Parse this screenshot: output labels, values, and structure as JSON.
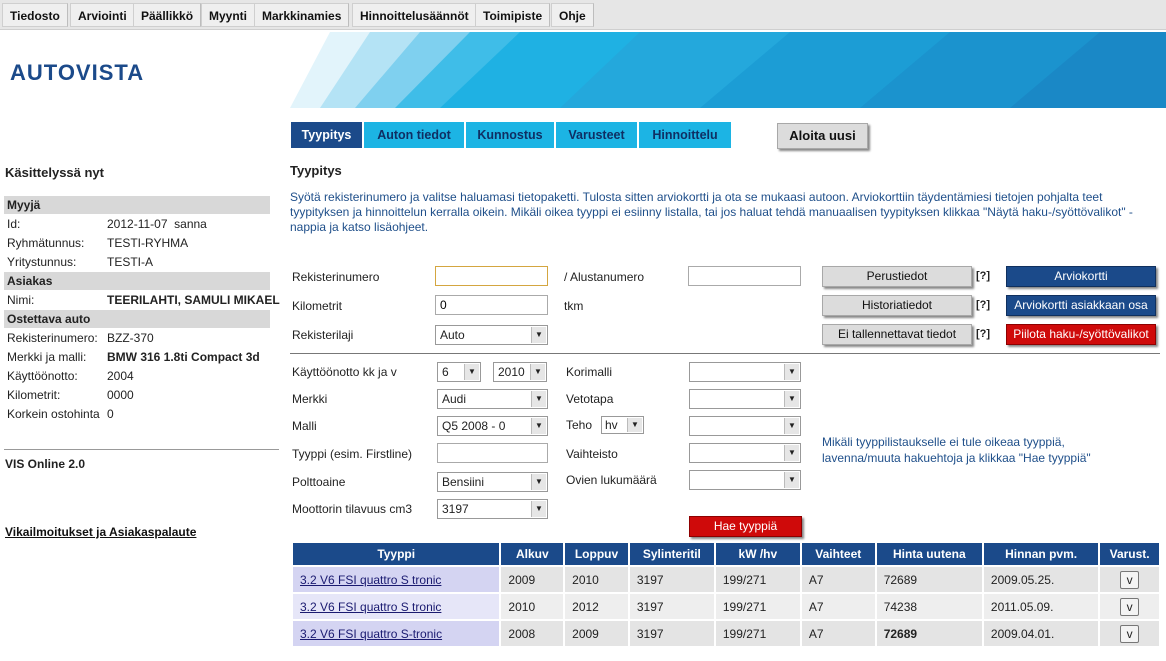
{
  "menu": [
    "Tiedosto",
    "Arviointi",
    "Päällikkö",
    "Myynti",
    "Markkinamies",
    "Hinnoittelusäännöt",
    "Toimipiste",
    "Ohje"
  ],
  "brand": "AUTOVISTA",
  "tabs": [
    "Tyypitys",
    "Auton tiedot",
    "Kunnostus",
    "Varusteet",
    "Hinnoittelu"
  ],
  "start_over": "Aloita uusi",
  "sidebar": {
    "title": "Käsittelyssä nyt",
    "myyja_head": "Myyjä",
    "id_label": "Id:",
    "id_value": "2012-11-07  sanna",
    "group_label": "Ryhmätunnus:",
    "group_value": "TESTI-RYHMA",
    "company_label": "Yritystunnus:",
    "company_value": "TESTI-A",
    "asiakas_head": "Asiakas",
    "name_label": "Nimi:",
    "name_value": "TEERILAHTI, SAMULI MIKAEL",
    "car_head": "Ostettava auto",
    "reg_label": "Rekisterinumero:",
    "reg_value": "BZZ-370",
    "make_label": "Merkki ja malli:",
    "make_value": "BMW 316 1.8ti Compact 3d",
    "use_label": "Käyttöönotto:",
    "use_value": "2004",
    "km_label": "Kilometrit:",
    "km_value": "0000",
    "max_label": "Korkein ostohinta",
    "max_value": "0",
    "version": "VIS Online 2.0",
    "feedback": "Vikailmoitukset ja Asiakaspalaute"
  },
  "section_title": "Tyypitys",
  "intro": "Syötä rekisterinumero ja valitse haluamasi tietopaketti. Tulosta sitten arviokortti ja ota se mukaasi autoon. Arviokorttiin täydentämiesi tietojen pohjalta teet tyypityksen ja hinnoittelun kerralla oikein. Mikäli oikea tyyppi ei esiinny listalla, tai jos haluat tehdä manuaalisen tyypityksen klikkaa \"Näytä haku-/syöttövalikot\" -nappia ja katso lisäohjeet.",
  "form": {
    "reg_label": "Rekisterinumero",
    "reg_value": "",
    "chassis_label": "/ Alustanumero",
    "chassis_value": "",
    "km_label": "Kilometrit",
    "km_value": "0",
    "km_unit": "tkm",
    "reglaji_label": "Rekisterilaji",
    "reglaji_value": "Auto",
    "kaytto_label": "Käyttöönotto kk ja v",
    "kaytto_month": "6",
    "kaytto_year": "2010",
    "merkki_label": "Merkki",
    "merkki_value": "Audi",
    "malli_label": "Malli",
    "malli_value": "Q5 2008 - 0",
    "tyyppi_label": "Tyyppi (esim. Firstline)",
    "tyyppi_value": "",
    "polttoaine_label": "Polttoaine",
    "polttoaine_value": "Bensiini",
    "tilavuus_label": "Moottorin tilavuus cm3",
    "tilavuus_value": "3197",
    "korimalli_label": "Korimalli",
    "vetotapa_label": "Vetotapa",
    "teho_label": "Teho",
    "teho_unit": "hv",
    "vaihteisto_label": "Vaihteisto",
    "ovet_label": "Ovien lukumäärä",
    "hint": "Mikäli tyyppilistaukselle ei tule oikeaa tyyppiä, lavenna/muuta hakuehtoja ja klikkaa \"Hae tyyppiä\"",
    "search_button": "Hae tyyppiä"
  },
  "buttons": {
    "perustiedot": "Perustiedot",
    "historiatiedot": "Historiatiedot",
    "ei_tallennettavat": "Ei tallennettavat tiedot",
    "help": "[?]",
    "arviokortti": "Arviokortti",
    "arviokortti_asiakas": "Arviokortti asiakkaan osa",
    "piilota": "Piilota haku-/syöttövalikot"
  },
  "table": {
    "headers": [
      "Tyyppi",
      "Alkuv",
      "Loppuv",
      "Sylinteritil",
      "kW /hv",
      "Vaihteet",
      "Hinta uutena",
      "Hinnan pvm.",
      "Varust."
    ],
    "rows": [
      [
        "3.2 V6 FSI quattro S tronic",
        "2009",
        "2010",
        "3197",
        "199/271",
        "A7",
        "72689",
        "2009.05.25.",
        "v"
      ],
      [
        "3.2 V6 FSI quattro S tronic",
        "2010",
        "2012",
        "3197",
        "199/271",
        "A7",
        "74238",
        "2011.05.09.",
        "v"
      ],
      [
        "3.2 V6 FSI quattro S-tronic",
        "2008",
        "2009",
        "3197",
        "199/271",
        "A7",
        "72689",
        "2009.04.01.",
        "v"
      ]
    ]
  }
}
